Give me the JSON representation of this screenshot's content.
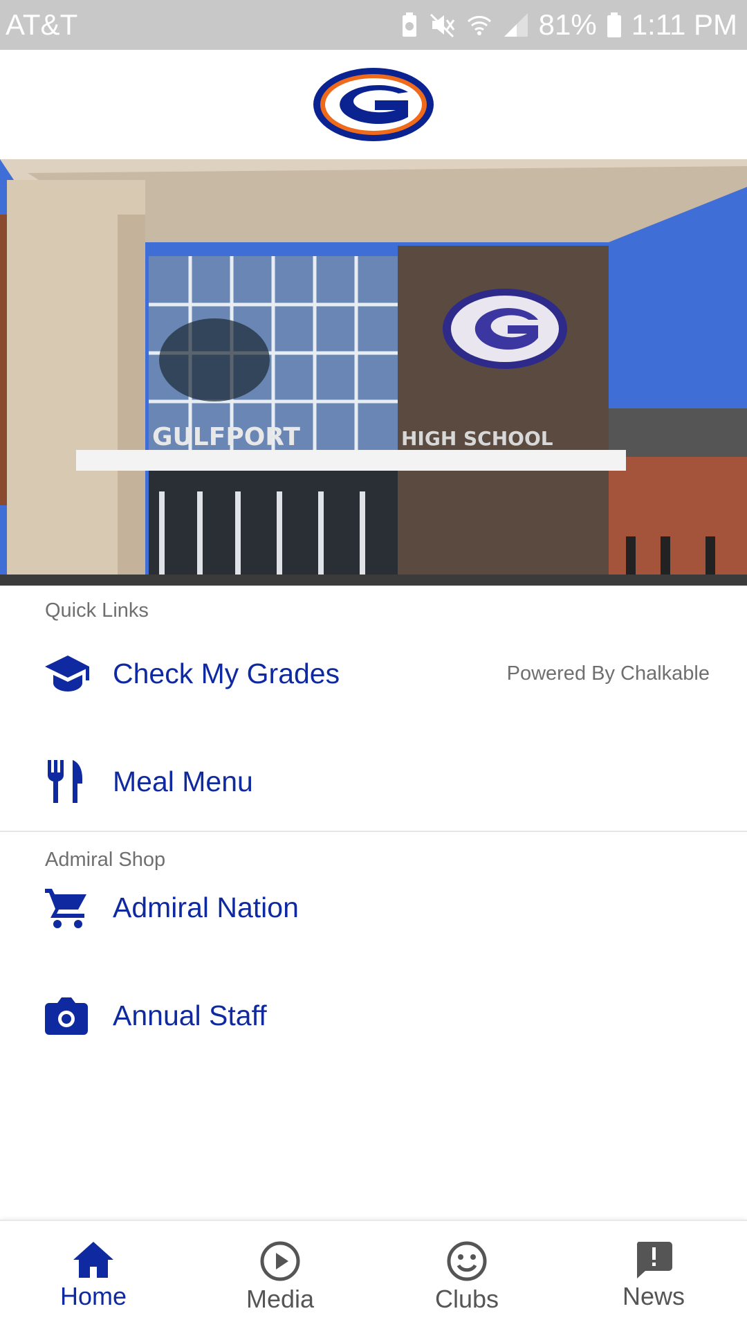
{
  "status_bar": {
    "carrier": "AT&T",
    "battery": "81%",
    "time": "1:11 PM"
  },
  "header": {
    "logo_letter": "G"
  },
  "hero": {
    "sign_left": "GULFPORT",
    "sign_right": "HIGH SCHOOL",
    "logo_letter": "G"
  },
  "quick_links": {
    "title": "Quick Links",
    "items": [
      {
        "label": "Check My Grades",
        "note": "Powered By Chalkable",
        "icon": "graduation-cap-icon"
      },
      {
        "label": "Meal Menu",
        "icon": "fork-knife-icon"
      }
    ]
  },
  "admiral_shop": {
    "title": "Admiral Shop",
    "items": [
      {
        "label": "Admiral Nation",
        "icon": "cart-icon"
      },
      {
        "label": "Annual Staff",
        "icon": "camera-icon"
      }
    ]
  },
  "bottom_nav": {
    "items": [
      {
        "label": "Home",
        "icon": "home-icon",
        "active": true
      },
      {
        "label": "Media",
        "icon": "play-circle-icon"
      },
      {
        "label": "Clubs",
        "icon": "smiley-icon"
      },
      {
        "label": "News",
        "icon": "alert-bubble-icon"
      }
    ]
  },
  "colors": {
    "primary": "#0f2aa0",
    "logo_blue": "#0a2391",
    "logo_orange": "#ef6a1b",
    "status_bar": "#c8c8c8",
    "muted_text": "#6f6f6f"
  }
}
